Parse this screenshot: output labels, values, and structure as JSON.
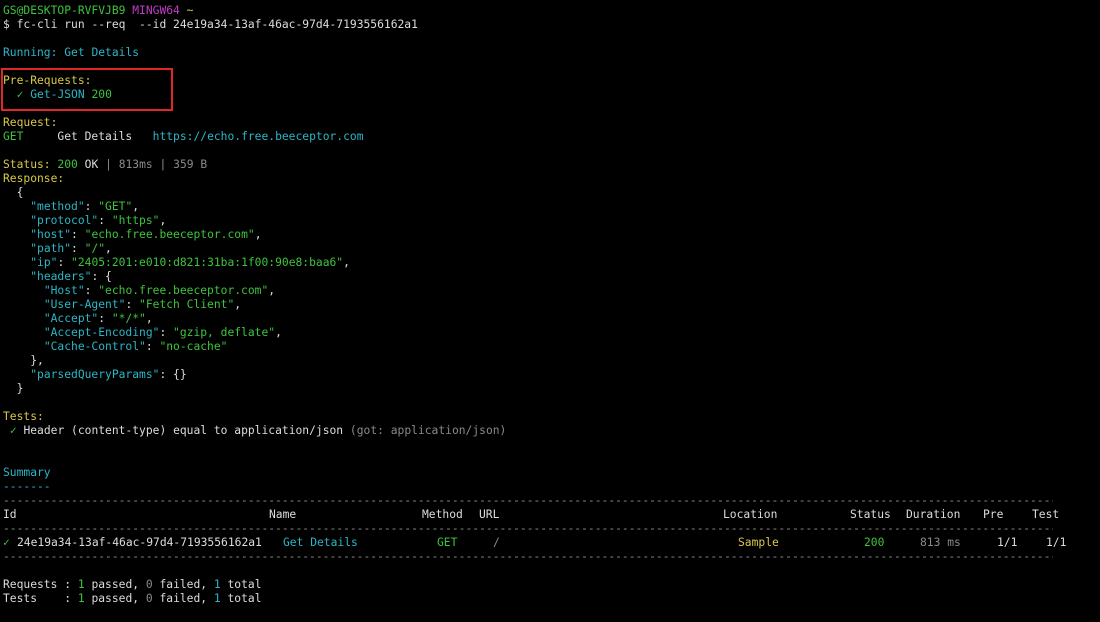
{
  "prompt": {
    "user_host": "GS@DESKTOP-RVFVJB9",
    "env": "MINGW64",
    "cwd": "~",
    "symbol": "$",
    "command": "fc-cli run --req  --id 24e19a34-13af-46ac-97d4-7193556162a1"
  },
  "running": {
    "label": "Running:",
    "name": "Get Details"
  },
  "pre_requests": {
    "header": "Pre-Requests:",
    "items": [
      {
        "check": "✓",
        "name": "Get-JSON",
        "status": "200"
      }
    ]
  },
  "request": {
    "header": "Request:",
    "method": "GET",
    "name": "Get Details",
    "url": "https://echo.free.beeceptor.com"
  },
  "status_line": {
    "label": "Status:",
    "code": "200",
    "text": "OK",
    "sep": "|",
    "time": "813ms",
    "size": "359 B"
  },
  "response": {
    "header": "Response:",
    "lines": [
      {
        "indent": "  ",
        "parts": [
          {
            "t": "{",
            "c": "white"
          }
        ]
      },
      {
        "indent": "    ",
        "parts": [
          {
            "t": "\"method\"",
            "c": "jkey"
          },
          {
            "t": ": ",
            "c": "white"
          },
          {
            "t": "\"GET\"",
            "c": "jgreen"
          },
          {
            "t": ",",
            "c": "white"
          }
        ]
      },
      {
        "indent": "    ",
        "parts": [
          {
            "t": "\"protocol\"",
            "c": "jkey"
          },
          {
            "t": ": ",
            "c": "white"
          },
          {
            "t": "\"https\"",
            "c": "jgreen"
          },
          {
            "t": ",",
            "c": "white"
          }
        ]
      },
      {
        "indent": "    ",
        "parts": [
          {
            "t": "\"host\"",
            "c": "jkey"
          },
          {
            "t": ": ",
            "c": "white"
          },
          {
            "t": "\"echo.free.beeceptor.com\"",
            "c": "jgreen"
          },
          {
            "t": ",",
            "c": "white"
          }
        ]
      },
      {
        "indent": "    ",
        "parts": [
          {
            "t": "\"path\"",
            "c": "jkey"
          },
          {
            "t": ": ",
            "c": "white"
          },
          {
            "t": "\"/\"",
            "c": "jgreen"
          },
          {
            "t": ",",
            "c": "white"
          }
        ]
      },
      {
        "indent": "    ",
        "parts": [
          {
            "t": "\"ip\"",
            "c": "jkey"
          },
          {
            "t": ": ",
            "c": "white"
          },
          {
            "t": "\"2405:201:e010:d821:31ba:1f00:90e8:baa6\"",
            "c": "jgreen"
          },
          {
            "t": ",",
            "c": "white"
          }
        ]
      },
      {
        "indent": "    ",
        "parts": [
          {
            "t": "\"headers\"",
            "c": "jkey"
          },
          {
            "t": ": {",
            "c": "white"
          }
        ]
      },
      {
        "indent": "      ",
        "parts": [
          {
            "t": "\"Host\"",
            "c": "jkey"
          },
          {
            "t": ": ",
            "c": "white"
          },
          {
            "t": "\"echo.free.beeceptor.com\"",
            "c": "jgreen"
          },
          {
            "t": ",",
            "c": "white"
          }
        ]
      },
      {
        "indent": "      ",
        "parts": [
          {
            "t": "\"User-Agent\"",
            "c": "jkey"
          },
          {
            "t": ": ",
            "c": "white"
          },
          {
            "t": "\"Fetch Client\"",
            "c": "jgreen"
          },
          {
            "t": ",",
            "c": "white"
          }
        ]
      },
      {
        "indent": "      ",
        "parts": [
          {
            "t": "\"Accept\"",
            "c": "jkey"
          },
          {
            "t": ": ",
            "c": "white"
          },
          {
            "t": "\"*/*\"",
            "c": "jgreen"
          },
          {
            "t": ",",
            "c": "white"
          }
        ]
      },
      {
        "indent": "      ",
        "parts": [
          {
            "t": "\"Accept-Encoding\"",
            "c": "jkey"
          },
          {
            "t": ": ",
            "c": "white"
          },
          {
            "t": "\"gzip, deflate\"",
            "c": "jgreen"
          },
          {
            "t": ",",
            "c": "white"
          }
        ]
      },
      {
        "indent": "      ",
        "parts": [
          {
            "t": "\"Cache-Control\"",
            "c": "jkey"
          },
          {
            "t": ": ",
            "c": "white"
          },
          {
            "t": "\"no-cache\"",
            "c": "jgreen"
          }
        ]
      },
      {
        "indent": "    ",
        "parts": [
          {
            "t": "},",
            "c": "white"
          }
        ]
      },
      {
        "indent": "    ",
        "parts": [
          {
            "t": "\"parsedQueryParams\"",
            "c": "jkey"
          },
          {
            "t": ": {}",
            "c": "white"
          }
        ]
      },
      {
        "indent": "  ",
        "parts": [
          {
            "t": "}",
            "c": "white"
          }
        ]
      }
    ]
  },
  "tests": {
    "header": "Tests:",
    "items": [
      {
        "check": "✓",
        "text": "Header (content-type) equal to application/json",
        "got": "(got: application/json)"
      }
    ]
  },
  "summary": {
    "title": "Summary",
    "underline": "-------",
    "rule": "-----------------------------------------------------------------------------------------------------------------------------------------------------------------",
    "columns": {
      "id": "Id",
      "name": "Name",
      "method": "Method",
      "url": "URL",
      "location": "Location",
      "status": "Status",
      "duration": "Duration",
      "pre": "Pre",
      "test": "Test"
    },
    "rows": [
      {
        "check": "✓",
        "id": "24e19a34-13af-46ac-97d4-7193556162a1",
        "name": "Get Details",
        "method": "GET",
        "url": "/",
        "location": "Sample",
        "status": "200",
        "duration": "813 ms",
        "pre": "1/1",
        "test": "1/1"
      }
    ],
    "totals": [
      {
        "label": "Requests",
        "sep": " : ",
        "passed": "1",
        "passed_text": " passed, ",
        "failed": "0",
        "failed_text": " failed, ",
        "total": "1",
        "total_text": " total"
      },
      {
        "label": "Tests   ",
        "sep": " : ",
        "passed": "1",
        "passed_text": " passed, ",
        "failed": "0",
        "failed_text": " failed, ",
        "total": "1",
        "total_text": " total"
      }
    ]
  },
  "colors": {
    "background": "#000000",
    "text": "#dcdcdc",
    "green": "#3ec33e",
    "cyan": "#2bb6c6",
    "yellow": "#d7c846",
    "magenta": "#c13cc8",
    "gray": "#8a8a8a",
    "highlight_border": "#e02727"
  }
}
